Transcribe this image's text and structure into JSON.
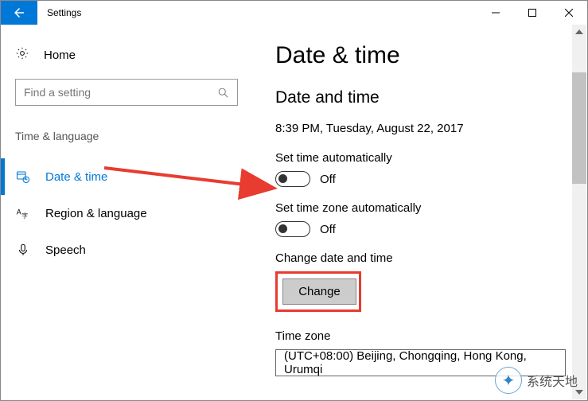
{
  "titlebar": {
    "app_name": "Settings"
  },
  "sidebar": {
    "home_label": "Home",
    "search_placeholder": "Find a setting",
    "group_label": "Time & language",
    "items": [
      {
        "label": "Date & time"
      },
      {
        "label": "Region & language"
      },
      {
        "label": "Speech"
      }
    ]
  },
  "main": {
    "page_title": "Date & time",
    "section_title": "Date and time",
    "current_datetime": "8:39 PM, Tuesday, August 22, 2017",
    "set_time_auto_label": "Set time automatically",
    "set_time_auto_state": "Off",
    "set_tz_auto_label": "Set time zone automatically",
    "set_tz_auto_state": "Off",
    "change_label": "Change date and time",
    "change_button": "Change",
    "tz_label": "Time zone",
    "tz_value": "(UTC+08:00) Beijing, Chongqing, Hong Kong, Urumqi"
  },
  "watermark": {
    "text": "系统天地"
  },
  "annotation": {
    "highlight_color": "#e73c2f"
  }
}
